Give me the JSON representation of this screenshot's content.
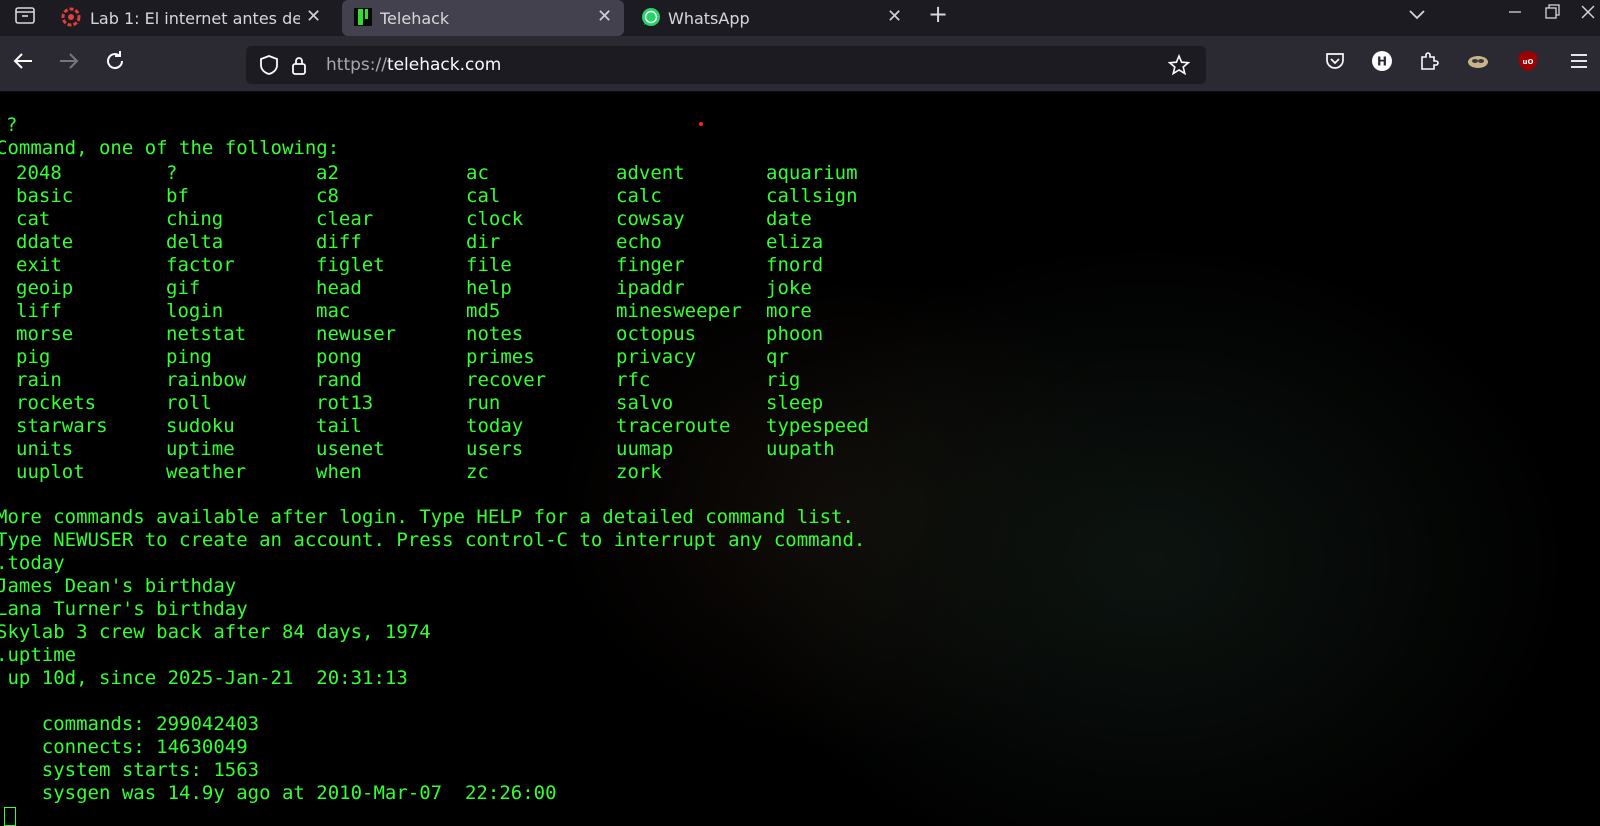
{
  "browser": {
    "tabs": [
      {
        "title": "Lab 1: El internet antes de la",
        "icon": "lab-site-icon",
        "active": false
      },
      {
        "title": "Telehack",
        "icon": "telehack-icon",
        "active": true
      },
      {
        "title": "WhatsApp",
        "icon": "whatsapp-icon",
        "active": false
      }
    ],
    "url_protocol": "https://",
    "url_host": "telehack.com"
  },
  "terminal": {
    "prompt_line": "?",
    "header": "Command, one of the following:",
    "commands": [
      [
        "2048",
        "?",
        "a2",
        "ac",
        "advent",
        "aquarium"
      ],
      [
        "basic",
        "bf",
        "c8",
        "cal",
        "calc",
        "callsign"
      ],
      [
        "cat",
        "ching",
        "clear",
        "clock",
        "cowsay",
        "date"
      ],
      [
        "ddate",
        "delta",
        "diff",
        "dir",
        "echo",
        "eliza"
      ],
      [
        "exit",
        "factor",
        "figlet",
        "file",
        "finger",
        "fnord"
      ],
      [
        "geoip",
        "gif",
        "head",
        "help",
        "ipaddr",
        "joke"
      ],
      [
        "liff",
        "login",
        "mac",
        "md5",
        "minesweeper",
        "more"
      ],
      [
        "morse",
        "netstat",
        "newuser",
        "notes",
        "octopus",
        "phoon"
      ],
      [
        "pig",
        "ping",
        "pong",
        "primes",
        "privacy",
        "qr"
      ],
      [
        "rain",
        "rainbow",
        "rand",
        "recover",
        "rfc",
        "rig"
      ],
      [
        "rockets",
        "roll",
        "rot13",
        "run",
        "salvo",
        "sleep"
      ],
      [
        "starwars",
        "sudoku",
        "tail",
        "today",
        "traceroute",
        "typespeed"
      ],
      [
        "units",
        "uptime",
        "usenet",
        "users",
        "uumap",
        "uupath"
      ],
      [
        "uuplot",
        "weather",
        "when",
        "zc",
        "zork",
        ""
      ]
    ],
    "more_line": "More commands available after login. Type HELP for a detailed command list.",
    "newuser_line": "Type NEWUSER to create an account. Press control-C to interrupt any command.",
    "today_cmd": ".today",
    "today_items": [
      "James Dean's birthday",
      "Lana Turner's birthday",
      "Skylab 3 crew back after 84 days, 1974"
    ],
    "uptime_cmd": ".uptime",
    "uptime_line": " up 10d, since 2025-Jan-21  20:31:13",
    "stats": [
      "    commands: 299042403",
      "    connects: 14630049",
      "    system starts: 1563",
      "    sysgen was 14.9y ago at 2010-Mar-07  22:26:00"
    ],
    "text_color": "#33ff33"
  }
}
